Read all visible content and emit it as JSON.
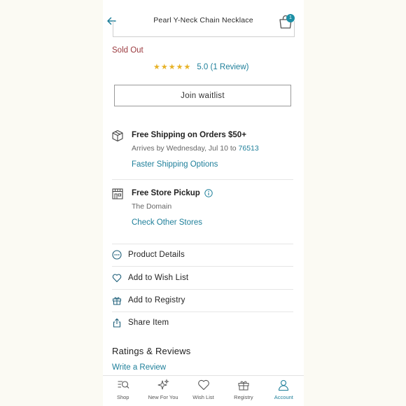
{
  "header": {
    "title": "Pearl Y-Neck Chain Necklace",
    "cart_count": "1"
  },
  "product": {
    "availability": "Sold Out",
    "stars": "★★★★★",
    "rating_text": "5.0 (1 Review)",
    "waitlist_label": "Join waitlist"
  },
  "shipping": {
    "title": "Free Shipping on Orders $50+",
    "arrives_prefix": "Arrives by Wednesday, Jul 10 to ",
    "zip": "76513",
    "link": "Faster Shipping Options"
  },
  "pickup": {
    "title": "Free Store Pickup",
    "store": "The Domain",
    "link": "Check Other Stores"
  },
  "actions": [
    {
      "label": "Product Details",
      "icon": "more-circle-icon"
    },
    {
      "label": "Add to Wish List",
      "icon": "heart-icon"
    },
    {
      "label": "Add to Registry",
      "icon": "gift-icon"
    },
    {
      "label": "Share Item",
      "icon": "share-icon"
    }
  ],
  "reviews": {
    "title": "Ratings & Reviews",
    "write_link": "Write a Review"
  },
  "tabbar": {
    "items": [
      {
        "label": "Shop",
        "icon": "search-list-icon"
      },
      {
        "label": "New For You",
        "icon": "sparkle-icon"
      },
      {
        "label": "Wish List",
        "icon": "heart-icon"
      },
      {
        "label": "Registry",
        "icon": "gift-icon"
      },
      {
        "label": "Account",
        "icon": "user-icon"
      }
    ],
    "active": "Account"
  },
  "colors": {
    "accent": "#1e7f9a",
    "sold_out": "#9b3a3f",
    "stars": "#e7b227",
    "badge": "#1d8fa5"
  }
}
